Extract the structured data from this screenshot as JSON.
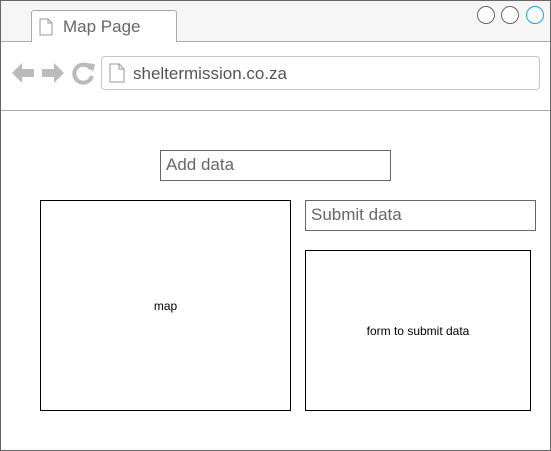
{
  "browser": {
    "tab_title": "Map Page",
    "url": "sheltermission.co.za"
  },
  "icons": {
    "tab": "document-icon",
    "back": "back-arrow-icon",
    "forward": "forward-arrow-icon",
    "reload": "reload-icon",
    "url": "document-icon"
  },
  "colors": {
    "accent": "#1ba1e2",
    "border": "#666666",
    "nav_icon": "#bbbbbb"
  },
  "page": {
    "add_data": "Add data",
    "submit_data": "Submit data",
    "map_label": "map",
    "form_label": "form to submit data"
  }
}
